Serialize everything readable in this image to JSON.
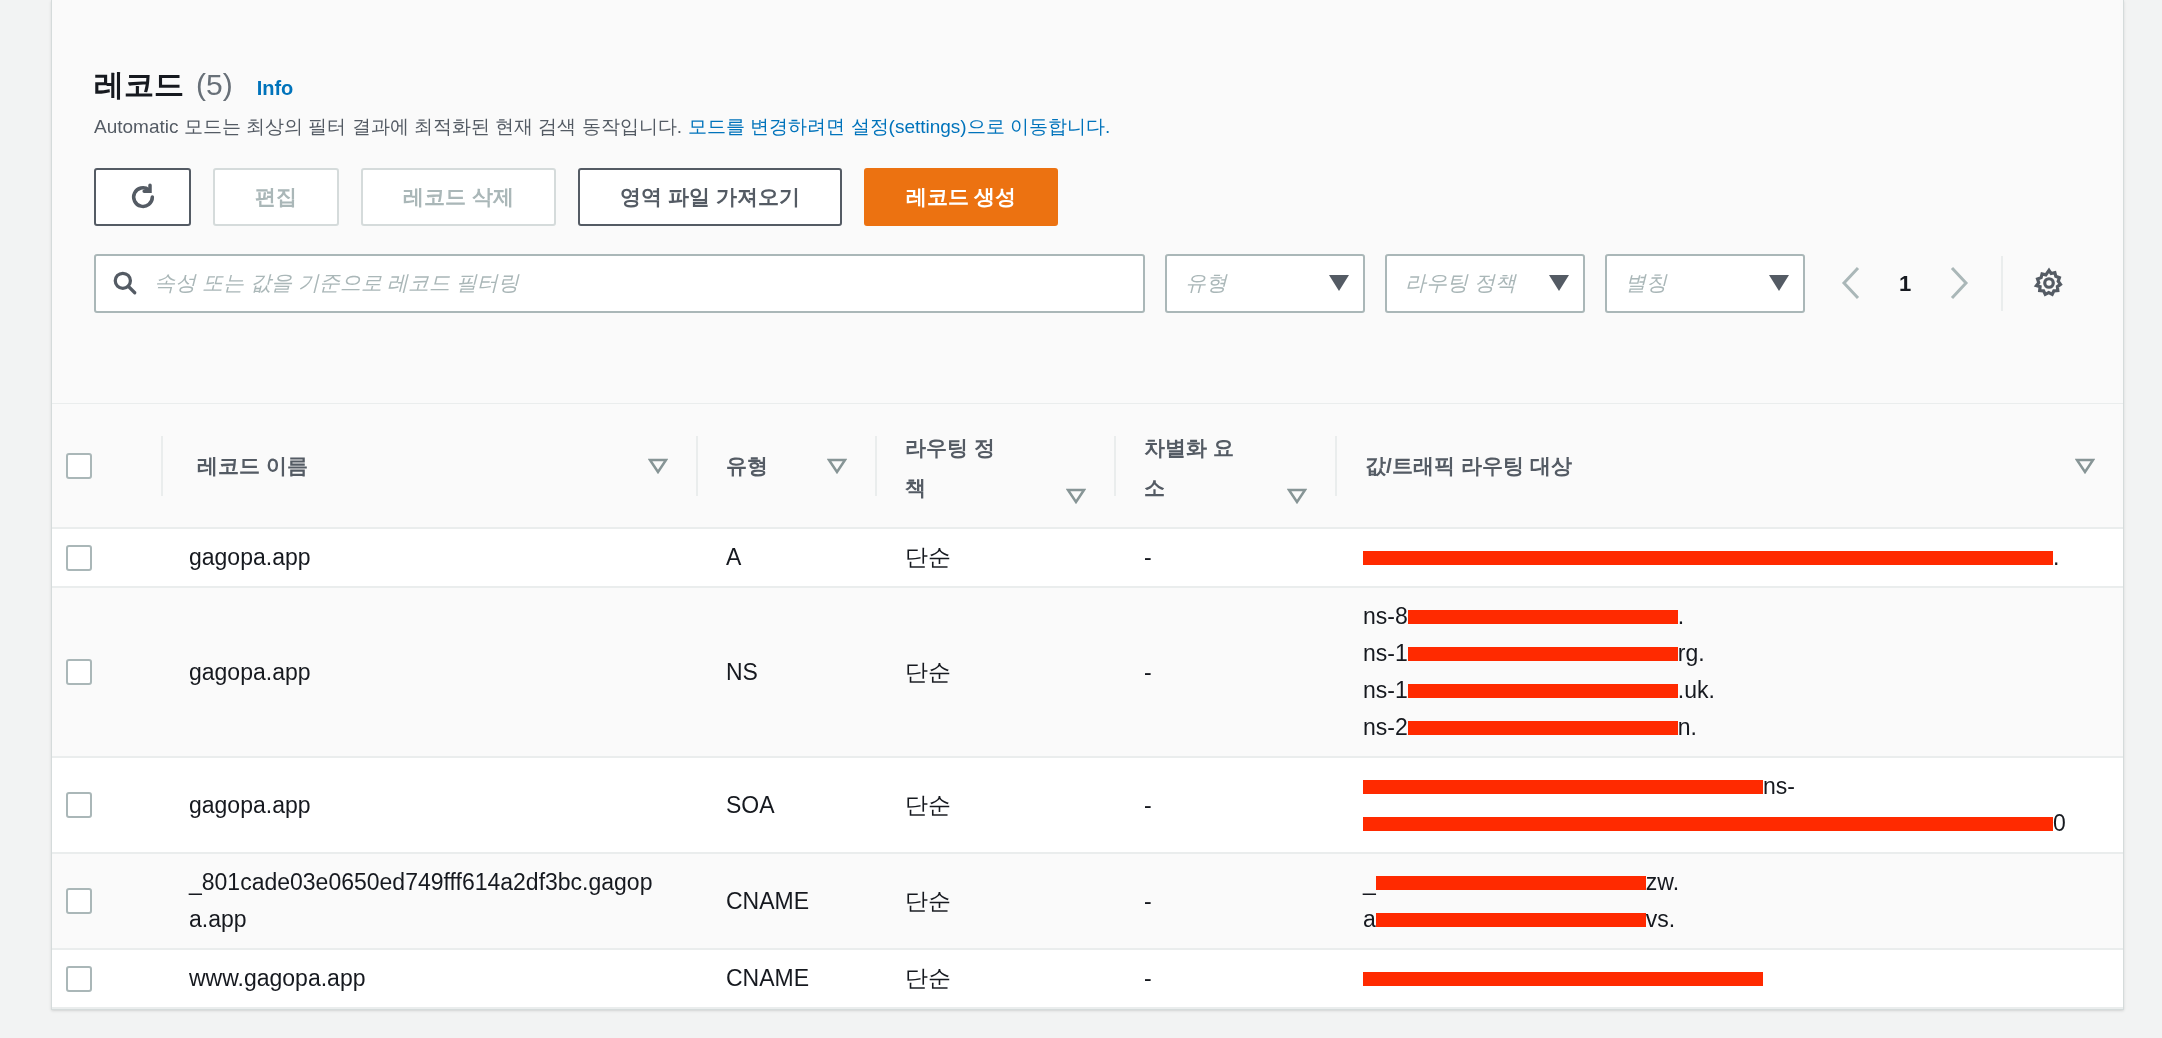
{
  "header": {
    "title": "레코드",
    "count": "(5)",
    "info": "Info",
    "description": "Automatic 모드는 최상의 필터 결과에 최적화된 현재 검색 동작입니다.",
    "settings_link": "모드를 변경하려면 설정(settings)으로 이동합니다."
  },
  "toolbar": {
    "buttons": [
      {
        "label": "편집",
        "disabled": true,
        "kind": "normal"
      },
      {
        "label": "레코드 삭제",
        "disabled": true,
        "kind": "normal"
      },
      {
        "label": "영역 파일 가져오기",
        "disabled": false,
        "kind": "normal"
      },
      {
        "label": "레코드 생성",
        "disabled": false,
        "kind": "primary"
      }
    ]
  },
  "filter": {
    "placeholder": "속성 또는 값을 기준으로 레코드 필터링",
    "dropdowns": [
      {
        "placeholder": "유형"
      },
      {
        "placeholder": "라우팅 정책"
      },
      {
        "placeholder": "별칭"
      }
    ],
    "page": "1"
  },
  "table": {
    "select_all": {
      "checked": false
    },
    "columns": [
      {
        "label": "레코드 이름"
      },
      {
        "label": "유형"
      },
      {
        "label": "라우팅 정책"
      },
      {
        "label": "차별화 요소"
      },
      {
        "label": "값/트래픽 라우팅 대상"
      }
    ],
    "rows": [
      {
        "checked": false,
        "name": "gagopa.app",
        "type": "A",
        "policy": "단순",
        "diff": "-",
        "value": [
          [
            {
              "kind": "redacted"
            },
            {
              "kind": "text",
              "text": "."
            }
          ]
        ]
      },
      {
        "checked": false,
        "name": "gagopa.app",
        "type": "NS",
        "policy": "단순",
        "diff": "-",
        "value": [
          [
            {
              "kind": "text",
              "text": "ns-8"
            },
            {
              "kind": "redacted"
            },
            {
              "kind": "text",
              "text": "."
            }
          ],
          [
            {
              "kind": "text",
              "text": "ns-1"
            },
            {
              "kind": "redacted"
            },
            {
              "kind": "text",
              "text": "rg."
            }
          ],
          [
            {
              "kind": "text",
              "text": "ns-1"
            },
            {
              "kind": "redacted"
            },
            {
              "kind": "text",
              "text": ".uk."
            }
          ],
          [
            {
              "kind": "text",
              "text": "ns-2"
            },
            {
              "kind": "redacted"
            },
            {
              "kind": "text",
              "text": "n."
            }
          ]
        ]
      },
      {
        "checked": false,
        "name": "gagopa.app",
        "type": "SOA",
        "policy": "단순",
        "diff": "-",
        "value": [
          [
            {
              "kind": "redacted"
            },
            {
              "kind": "text",
              "text": "ns-"
            }
          ],
          [
            {
              "kind": "redacted"
            },
            {
              "kind": "text",
              "text": "0"
            }
          ]
        ]
      },
      {
        "checked": false,
        "name": "_801cade03e0650ed749fff614a2df3bc.gagopa.app",
        "type": "CNAME",
        "policy": "단순",
        "diff": "-",
        "value": [
          [
            {
              "kind": "text",
              "text": "_"
            },
            {
              "kind": "redacted"
            },
            {
              "kind": "text",
              "text": "zw."
            }
          ],
          [
            {
              "kind": "text",
              "text": "a"
            },
            {
              "kind": "redacted"
            },
            {
              "kind": "text",
              "text": "vs."
            }
          ]
        ]
      },
      {
        "checked": false,
        "name": "www.gagopa.app",
        "type": "CNAME",
        "policy": "단순",
        "diff": "-",
        "value": [
          [
            {
              "kind": "redacted"
            }
          ]
        ]
      }
    ]
  }
}
